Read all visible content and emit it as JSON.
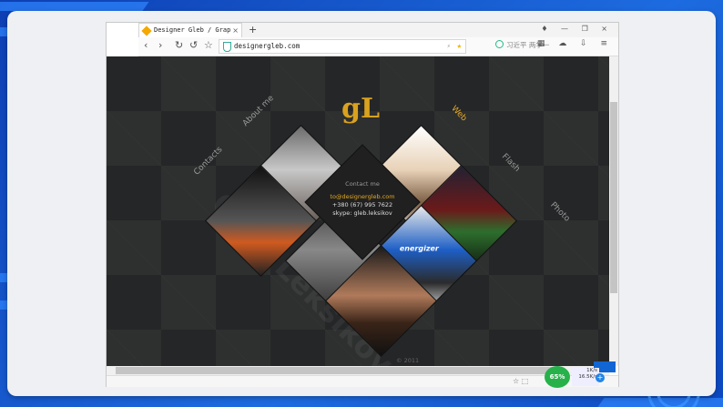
{
  "browser": {
    "tab_title": "Designer Gleb / Graphic",
    "tab_close": "×",
    "new_tab": "+",
    "window_controls": "♦ — ❐ ×",
    "url": "designergleb.com",
    "url_bolt": "⚡",
    "search_placeholder": "习近平 两学一",
    "nav": {
      "back": "‹",
      "forward": "›",
      "reload": "↻",
      "undo": "↺",
      "bookmark": "☆"
    },
    "toolbar_icons": "▦ ☁ ⇩ ≡"
  },
  "site": {
    "logo": "gL",
    "nav_items": [
      {
        "label": "About me"
      },
      {
        "label": "Web"
      },
      {
        "label": "Contacts"
      },
      {
        "label": "Flash"
      },
      {
        "label": "Photo"
      }
    ],
    "contact": {
      "heading": "Contact me",
      "email": "to@designergleb.com",
      "phone": "+380 (67) 995 7622",
      "skype": "skype: gleb.leksikov"
    },
    "watermark": "Gleb Leksikov",
    "copyright": "© 2011",
    "product_brand": "energizer"
  },
  "statusbar": {
    "speed": "65%",
    "net_up": "1K/s",
    "net_down": "16.5K/s",
    "add": "+"
  },
  "colors": {
    "accent": "#f5a800",
    "page_bg": "#252627",
    "frame_blue": "#1a56c8"
  }
}
